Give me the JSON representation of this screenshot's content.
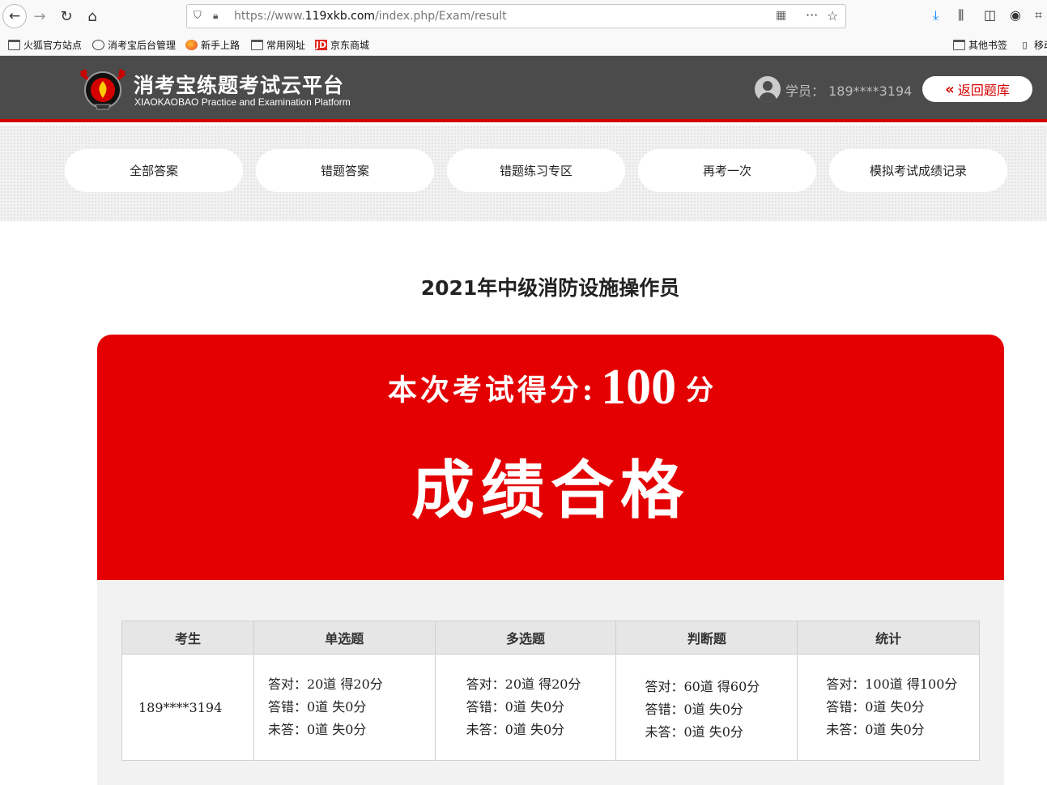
{
  "browser": {
    "url_prefix": "https://www.",
    "url_domain": "119xkb.com",
    "url_path": "/index.php/Exam/result"
  },
  "bookmarks": {
    "left": [
      "火狐官方站点",
      "消考宝后台管理",
      "新手上路",
      "常用网址",
      "京东商城"
    ],
    "right": [
      "其他书签",
      "移动"
    ]
  },
  "header": {
    "title": "消考宝练题考试云平台",
    "subtitle": "XIAOKAOBAO Practice and Examination Platform",
    "user_label": "学员： 189****3194",
    "return_button": "返回题库"
  },
  "nav": {
    "items": [
      "全部答案",
      "错题答案",
      "错题练习专区",
      "再考一次",
      "模拟考试成绩记录"
    ]
  },
  "exam": {
    "title": "2021年中级消防设施操作员",
    "score_label": "本次考试得分:",
    "score": "100",
    "score_unit": "分",
    "result": "成绩合格"
  },
  "table": {
    "headers": [
      "考生",
      "单选题",
      "多选题",
      "判断题",
      "统计"
    ],
    "candidate": "189****3194",
    "single": [
      "答对：20道 得20分",
      "答错：0道 失0分",
      "未答：0道 失0分"
    ],
    "multi": [
      "答对：20道 得20分",
      "答错：0道 失0分",
      "未答：0道 失0分"
    ],
    "judge": [
      "答对：60道 得60分",
      "答错：0道 失0分",
      "未答：0道 失0分"
    ],
    "total": [
      "答对：100道 得100分",
      "答错：0道 失0分",
      "未答：0道 失0分"
    ]
  },
  "colors": {
    "header_bg": "#4b4b4b",
    "accent_red": "#e40000",
    "banner_red": "#e40000"
  }
}
